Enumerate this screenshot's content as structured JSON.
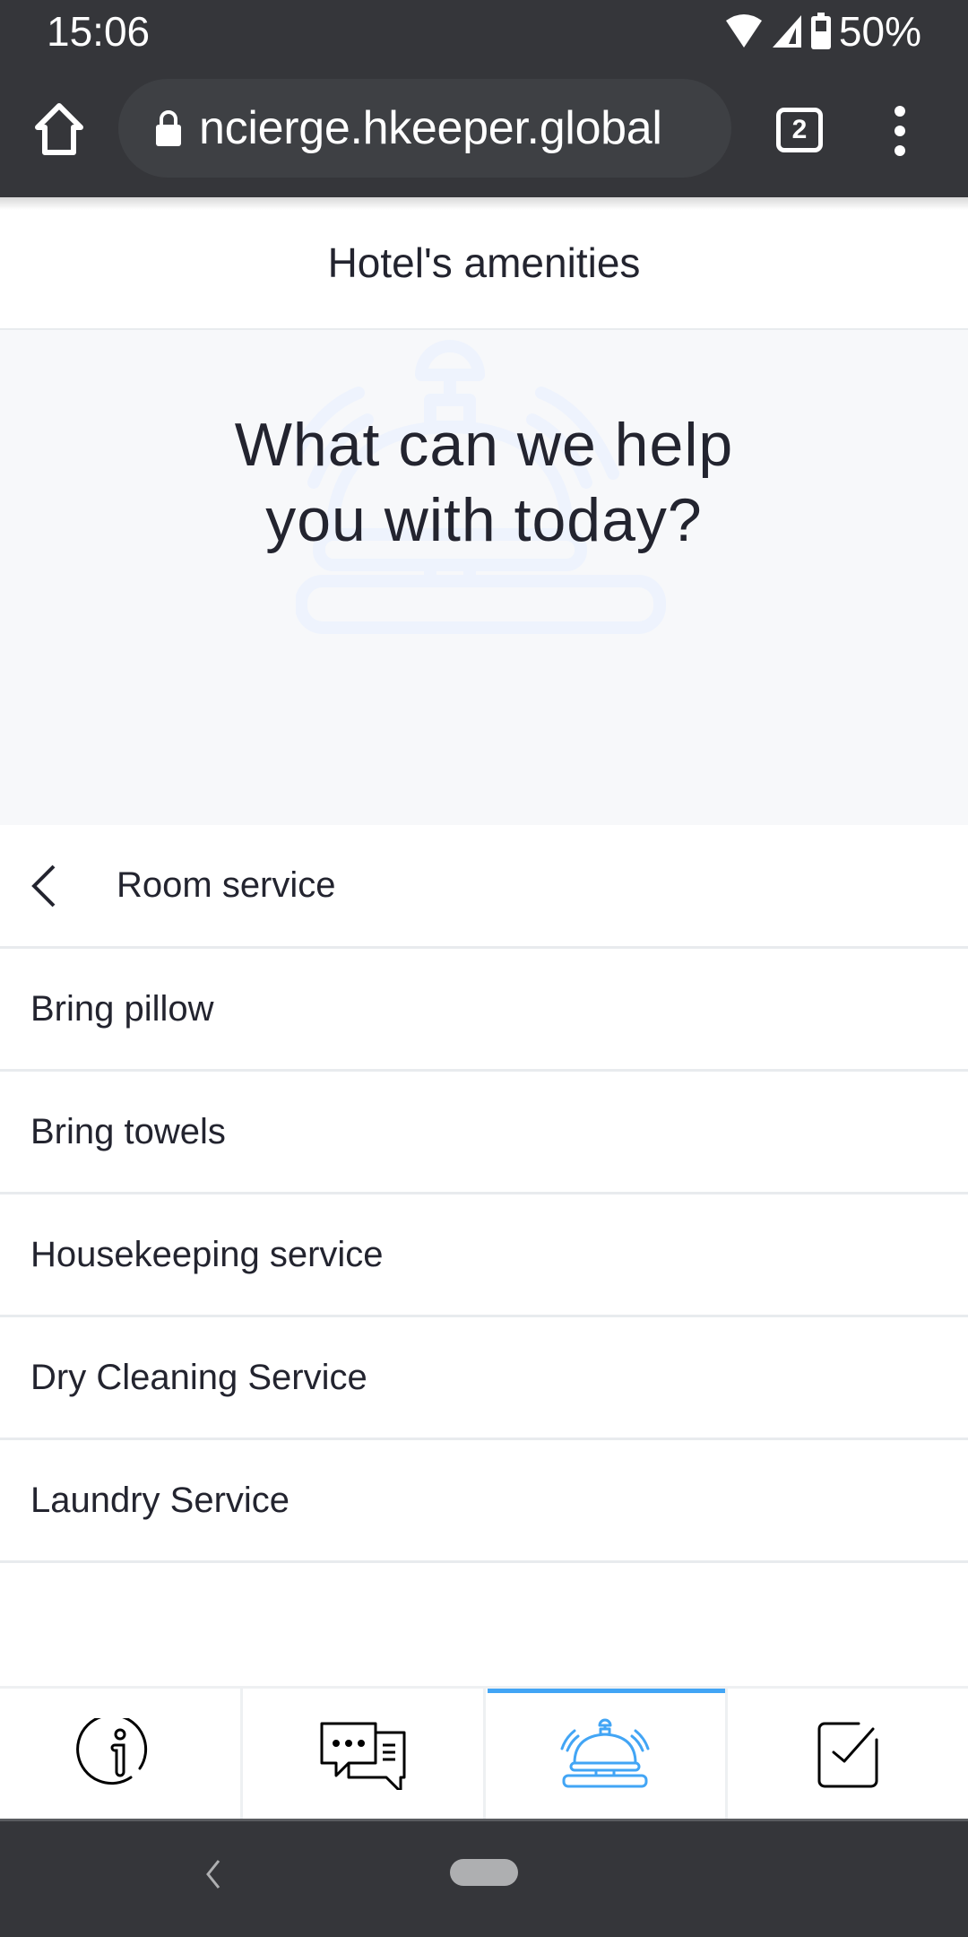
{
  "status_bar": {
    "time": "15:06",
    "battery_percent": "50%",
    "icons": [
      "wifi-icon",
      "cellular-signal-icon",
      "battery-icon"
    ]
  },
  "browser": {
    "url": "ncierge.hkeeper.global",
    "tab_count": "2",
    "icons": [
      "home-icon",
      "lock-icon",
      "tab-switcher-icon",
      "overflow-menu-icon"
    ]
  },
  "page": {
    "title": "Hotel's amenities",
    "hero_heading_line1": "What can we help",
    "hero_heading_line2": "you with today?",
    "hero_icon": "service-bell-icon"
  },
  "category": {
    "label": "Room service",
    "back_icon": "chevron-left-icon"
  },
  "services": [
    {
      "label": "Bring pillow"
    },
    {
      "label": "Bring towels"
    },
    {
      "label": "Housekeeping service"
    },
    {
      "label": "Dry Cleaning Service"
    },
    {
      "label": "Laundry Service"
    }
  ],
  "bottom_nav": {
    "tabs": [
      {
        "name": "info",
        "icon": "info-icon",
        "active": false
      },
      {
        "name": "chat",
        "icon": "chat-bubbles-icon",
        "active": false
      },
      {
        "name": "amenities",
        "icon": "service-bell-icon",
        "active": true
      },
      {
        "name": "tasks",
        "icon": "checkbox-icon",
        "active": false
      }
    ],
    "active_color": "#42a5f5"
  },
  "colors": {
    "system_bar": "#35363a",
    "text": "#23242f",
    "hero_bg": "#f7f8fa",
    "divider": "#e8ebee",
    "accent": "#42a5f5"
  }
}
